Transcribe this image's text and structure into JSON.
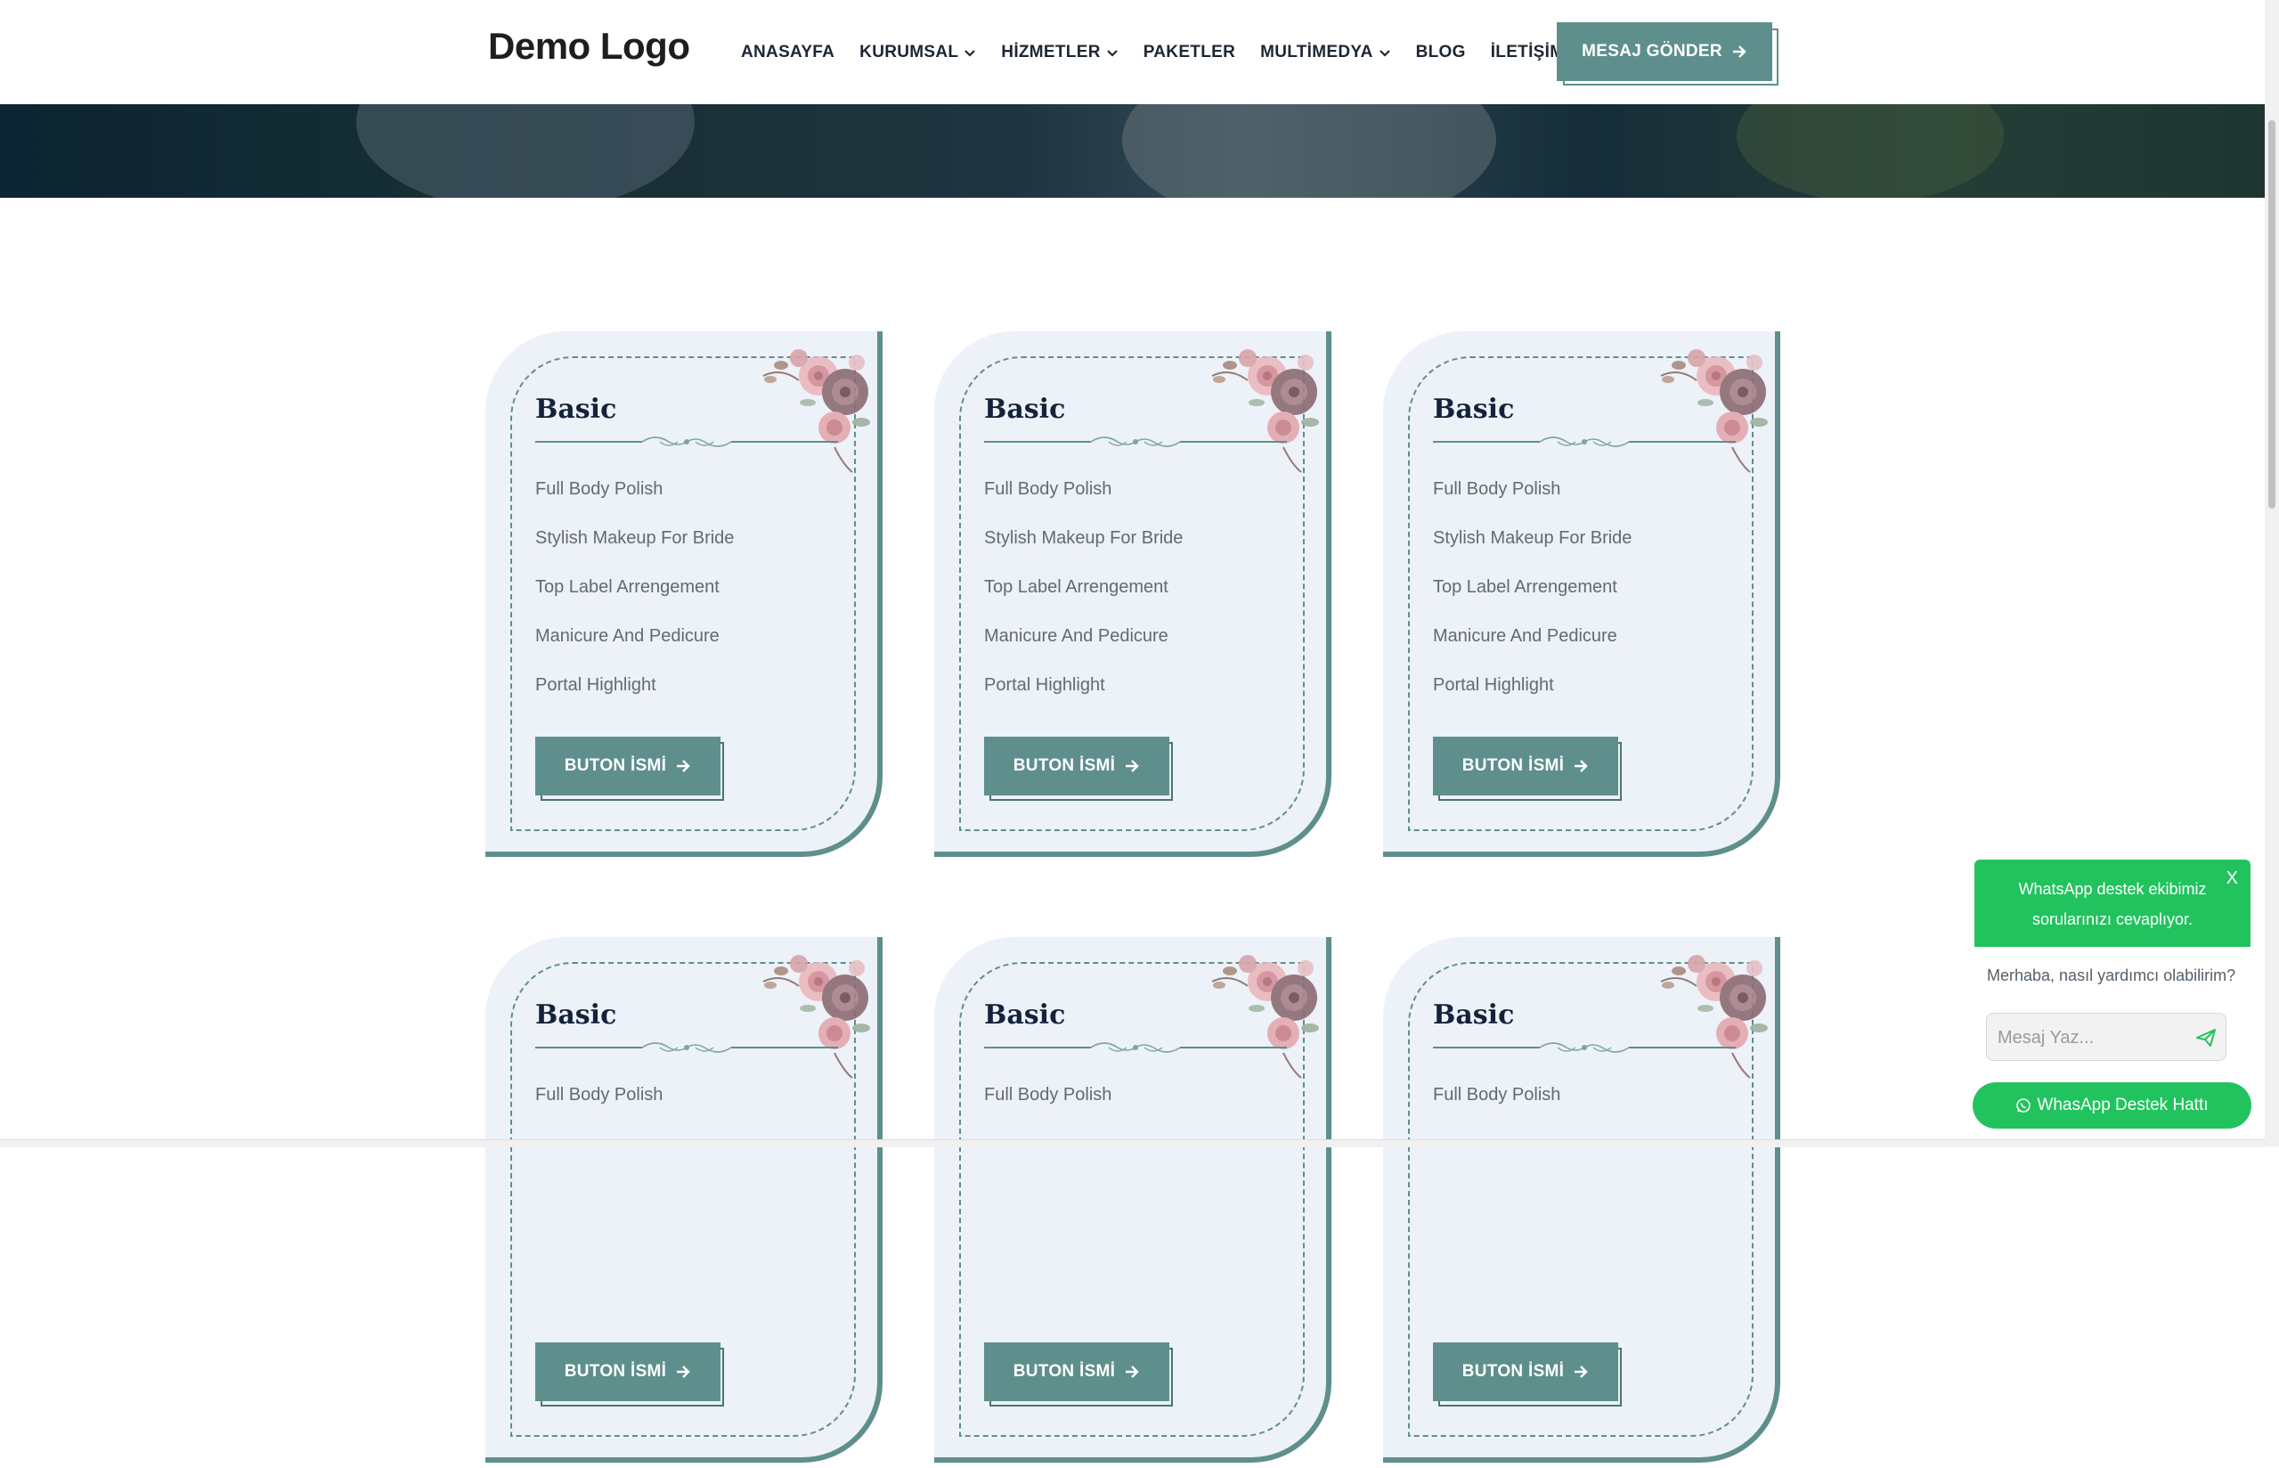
{
  "header": {
    "logo": "Demo Logo",
    "nav": [
      {
        "label": "ANASAYFA",
        "dropdown": false
      },
      {
        "label": "KURUMSAL",
        "dropdown": true
      },
      {
        "label": "HİZMETLER",
        "dropdown": true
      },
      {
        "label": "PAKETLER",
        "dropdown": false
      },
      {
        "label": "MULTİMEDYA",
        "dropdown": true
      },
      {
        "label": "BLOG",
        "dropdown": false
      },
      {
        "label": "İLETİŞİM",
        "dropdown": false
      }
    ],
    "cta_label": "MESAJ GÖNDER"
  },
  "colors": {
    "accent": "#5e8f8c",
    "card_bg": "#edf1f8",
    "whatsapp": "#22c35e"
  },
  "cards": [
    {
      "title": "Basic",
      "features": [
        "Full Body Polish",
        "Stylish Makeup For Bride",
        "Top Label Arrengement",
        "Manicure And Pedicure",
        "Portal Highlight"
      ],
      "button": "BUTON İSMİ"
    },
    {
      "title": "Basic",
      "features": [
        "Full Body Polish",
        "Stylish Makeup For Bride",
        "Top Label Arrengement",
        "Manicure And Pedicure",
        "Portal Highlight"
      ],
      "button": "BUTON İSMİ"
    },
    {
      "title": "Basic",
      "features": [
        "Full Body Polish",
        "Stylish Makeup For Bride",
        "Top Label Arrengement",
        "Manicure And Pedicure",
        "Portal Highlight"
      ],
      "button": "BUTON İSMİ"
    },
    {
      "title": "Basic",
      "features": [
        "Full Body Polish"
      ],
      "button": "BUTON İSMİ"
    },
    {
      "title": "Basic",
      "features": [
        "Full Body Polish"
      ],
      "button": "BUTON İSMİ"
    },
    {
      "title": "Basic",
      "features": [
        "Full Body Polish"
      ],
      "button": "BUTON İSMİ"
    }
  ],
  "whatsapp": {
    "header": "WhatsApp destek ekibimiz sorularınızı cevaplıyor.",
    "close": "X",
    "greeting": "Merhaba, nasıl yardımcı olabilirim?",
    "input_placeholder": "Mesaj Yaz...",
    "button_label": "WhasApp Destek Hattı"
  }
}
